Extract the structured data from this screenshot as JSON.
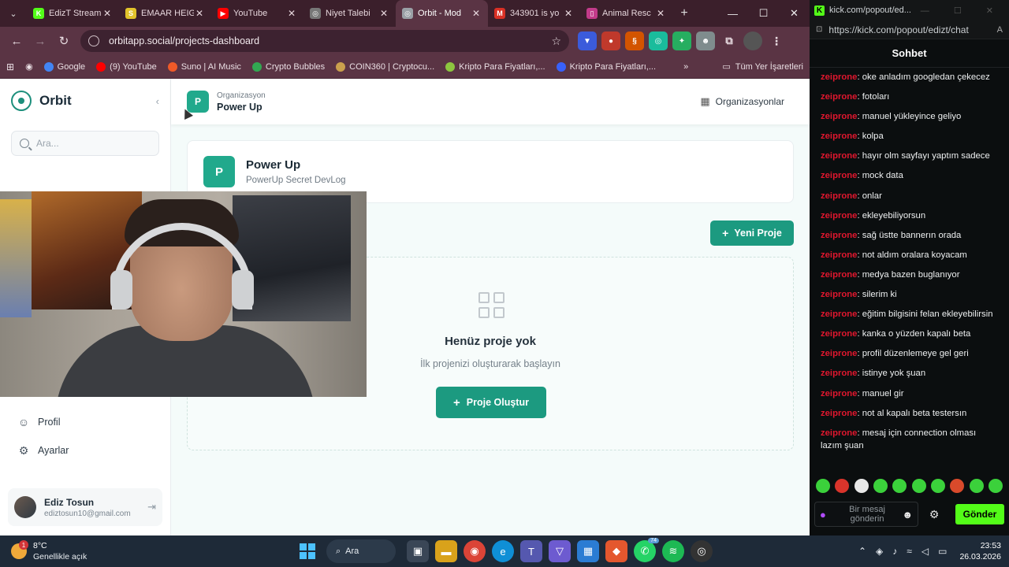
{
  "browser": {
    "tabs": [
      {
        "label": "EdizT Stream",
        "color": "#53fc18",
        "glyph": "K"
      },
      {
        "label": "EMAAR HEIG",
        "color": "#e2c32b",
        "glyph": "S"
      },
      {
        "label": "YouTube",
        "color": "#ff0000",
        "glyph": "▶"
      },
      {
        "label": "Niyet Talebi",
        "color": "#777777",
        "glyph": "◎"
      },
      {
        "label": "Orbit - Mod",
        "color": "#9aa0a6",
        "glyph": "◎",
        "active": true
      },
      {
        "label": "343901 is yo",
        "color": "#d93025",
        "glyph": "M"
      },
      {
        "label": "Animal Resc",
        "color": "#c23b8a",
        "glyph": "▯"
      }
    ],
    "url": "orbitapp.social/projects-dashboard",
    "bookmarks": [
      {
        "label": "Google",
        "color": "#4285f4"
      },
      {
        "label": "(9) YouTube",
        "color": "#ff0000"
      },
      {
        "label": "Suno | AI Music",
        "color": "#f05a28"
      },
      {
        "label": "Crypto Bubbles",
        "color": "#32a852"
      },
      {
        "label": "COIN360 | Cryptocu...",
        "color": "#caa04d"
      },
      {
        "label": "Kripto Para Fiyatları,...",
        "color": "#8dc63f"
      },
      {
        "label": "Kripto Para Fiyatları,...",
        "color": "#3861fb"
      }
    ],
    "bookmarks_all": "Tüm Yer İşaretleri"
  },
  "sidebar": {
    "brand": "Orbit",
    "search_placeholder": "Ara...",
    "items": [
      {
        "label": "Profil",
        "icon": "user-icon"
      },
      {
        "label": "Ayarlar",
        "icon": "gear-icon"
      }
    ],
    "user": {
      "name": "Ediz Tosun",
      "email": "ediztosun10@gmail.com"
    }
  },
  "topbar": {
    "org_caption": "Organizasyon",
    "org_name": "Power Up",
    "org_initial": "P",
    "orgs_link": "Organizasyonlar"
  },
  "org_card": {
    "initial": "P",
    "title": "Power Up",
    "subtitle": "PowerUp Secret DevLog"
  },
  "new_project_button": "Yeni Proje",
  "empty_state": {
    "title": "Henüz proje yok",
    "subtitle": "İlk projenizi oluşturarak başlayın",
    "button": "Proje Oluştur"
  },
  "chat": {
    "window_title": "kick.com/popout/ed...",
    "url": "https://kick.com/popout/edizt/chat",
    "header": "Sohbet",
    "messages": [
      {
        "user": "zeiprone",
        "text": ": oke anladım googledan çekecez"
      },
      {
        "user": "zeiprone",
        "text": ": fotoları"
      },
      {
        "user": "zeiprone",
        "text": ": manuel yükleyince geliyo"
      },
      {
        "user": "zeiprone",
        "text": ": kolpa"
      },
      {
        "user": "zeiprone",
        "text": ": hayır olm sayfayı yaptım sadece"
      },
      {
        "user": "zeiprone",
        "text": ": mock data"
      },
      {
        "user": "zeiprone",
        "text": ": onlar"
      },
      {
        "user": "zeiprone",
        "text": ": ekleyebiliyorsun"
      },
      {
        "user": "zeiprone",
        "text": ": sağ üstte bannerın orada"
      },
      {
        "user": "zeiprone",
        "text": ": not aldım oralara koyacam"
      },
      {
        "user": "zeiprone",
        "text": ": medya bazen buglanıyor"
      },
      {
        "user": "zeiprone",
        "text": ": silerim ki"
      },
      {
        "user": "zeiprone",
        "text": ": eğitim bilgisini felan ekleyebilirsin"
      },
      {
        "user": "zeiprone",
        "text": ": kanka o yüzden kapalı beta"
      },
      {
        "user": "zeiprone",
        "text": ": profil düzenlemeye gel geri"
      },
      {
        "user": "zeiprone",
        "text": ": istinye yok şuan"
      },
      {
        "user": "zeiprone",
        "text": ": manuel gir"
      },
      {
        "user": "zeiprone",
        "text": ": not al kapalı beta testersın"
      },
      {
        "user": "zeiprone",
        "text": ": mesaj için connection olması lazım şuan"
      }
    ],
    "input_placeholder": "Bir mesaj gönderin",
    "send": "Gönder"
  },
  "taskbar": {
    "weather_temp": "8°C",
    "weather_desc": "Genellikle açık",
    "weather_badge": "1",
    "search": "Ara",
    "whatsapp_count": "74",
    "time": "23:53",
    "date": "26.03.2026"
  }
}
